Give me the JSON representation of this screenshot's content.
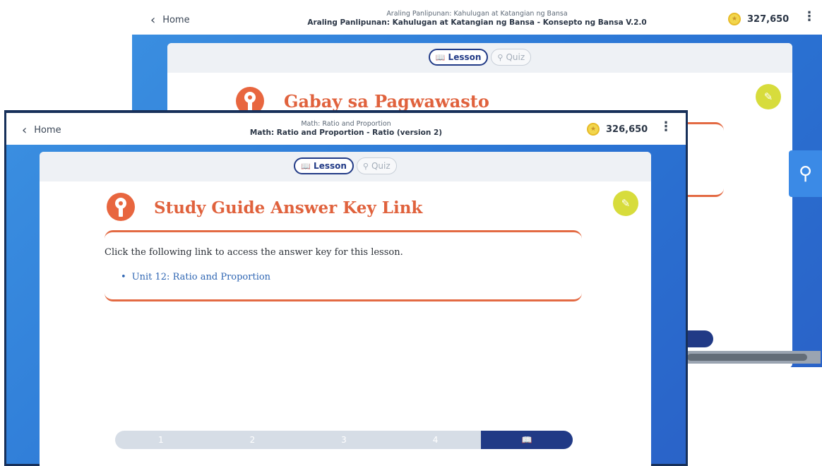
{
  "back_window": {
    "home_label": "Home",
    "title_small": "Araling Panlipunan: Kahulugan at Katangian ng Bansa",
    "title_main": "Araling Panlipunan: Kahulugan at Katangian ng Bansa - Konsepto ng Bansa V.2.0",
    "coins": "327,650",
    "tabs": {
      "lesson": "Lesson",
      "quiz": "Quiz"
    },
    "heading": "Gabay sa Pagwawasto"
  },
  "front_window": {
    "home_label": "Home",
    "title_small": "Math: Ratio and Proportion",
    "title_main": "Math: Ratio and Proportion - Ratio (version 2)",
    "coins": "326,650",
    "tabs": {
      "lesson": "Lesson",
      "quiz": "Quiz"
    },
    "heading": "Study Guide Answer Key Link",
    "body_text": "Click the following link to access the answer key for this lesson.",
    "links": [
      "Unit 12: Ratio and Proportion"
    ],
    "pager": [
      "1",
      "2",
      "3",
      "4"
    ],
    "pager_active": 5
  },
  "icons": {
    "back": "chevron-left-icon",
    "coin": "coin-icon",
    "menu": "kebab-menu-icon",
    "lesson": "book-icon",
    "quiz": "quiz-icon",
    "key": "key-icon",
    "edit": "pencil-icon"
  },
  "colors": {
    "accent": "#213a86",
    "heading": "#e0623d",
    "link": "#2f66b3",
    "edit_button": "#d7dc3c"
  }
}
